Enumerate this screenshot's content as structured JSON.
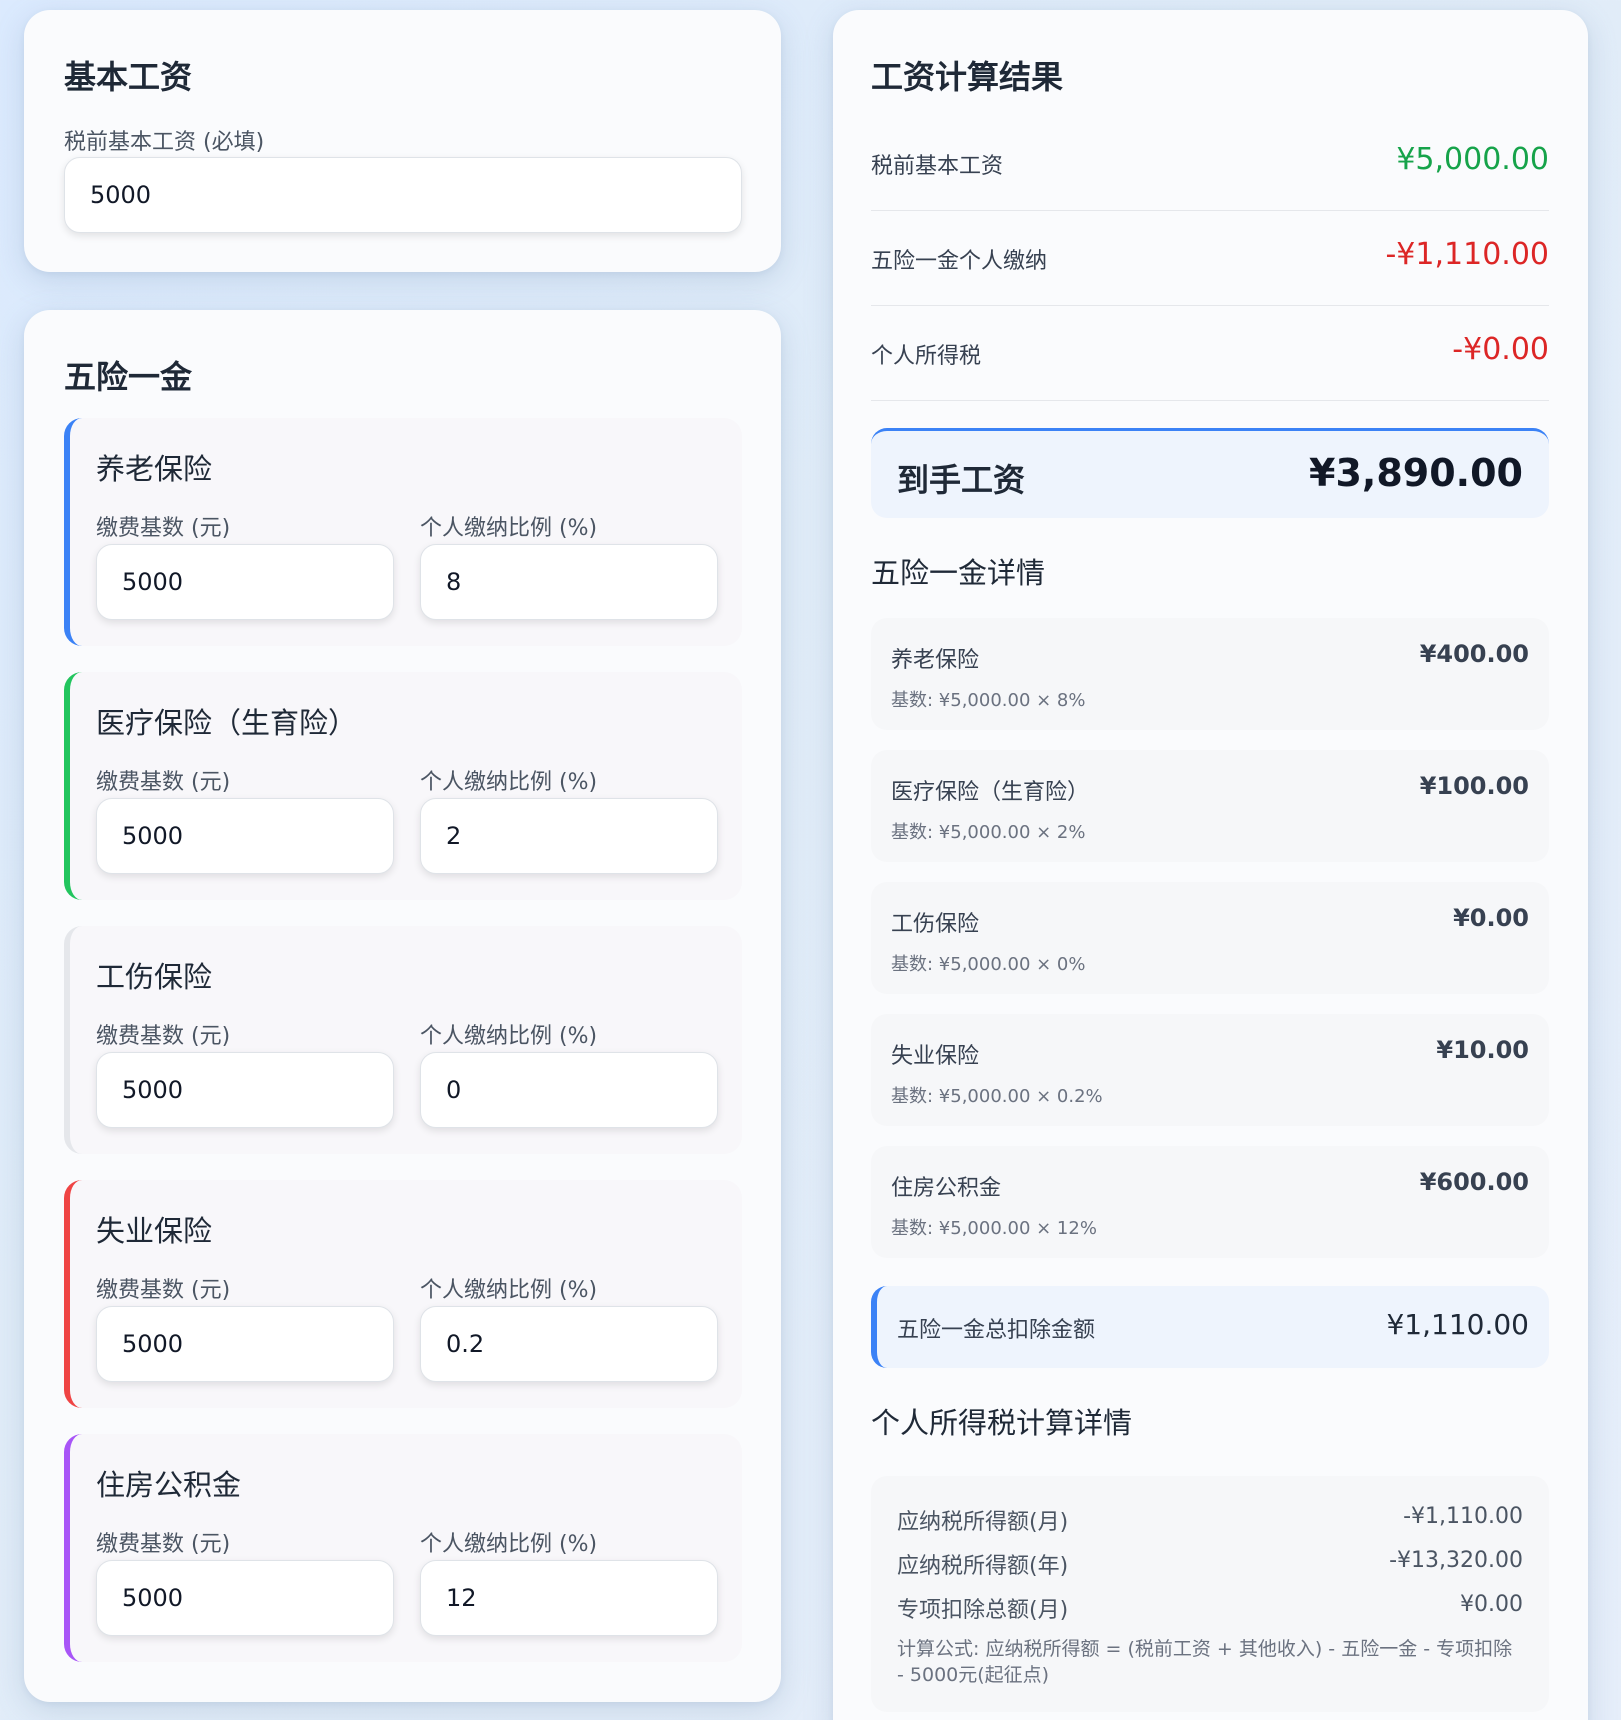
{
  "basic": {
    "title": "基本工资",
    "label": "税前基本工资 (必填)",
    "value": "5000"
  },
  "insurance": {
    "title": "五险一金",
    "base_label": "缴费基数 (元)",
    "rate_label": "个人缴纳比例 (%)",
    "items": [
      {
        "name": "养老保险",
        "base": "5000",
        "rate": "8",
        "color": "#3b82f6"
      },
      {
        "name": "医疗保险（生育险）",
        "base": "5000",
        "rate": "2",
        "color": "#22c55e"
      },
      {
        "name": "工伤保险",
        "base": "5000",
        "rate": "0",
        "color": "#e5e7eb"
      },
      {
        "name": "失业保险",
        "base": "5000",
        "rate": "0.2",
        "color": "#ef4444"
      },
      {
        "name": "住房公积金",
        "base": "5000",
        "rate": "12",
        "color": "#a855f7"
      }
    ]
  },
  "results": {
    "title": "工资计算结果",
    "rows": [
      {
        "label": "税前基本工资",
        "value": "¥5,000.00",
        "color": "#16a34a"
      },
      {
        "label": "五险一金个人缴纳",
        "value": "-¥1,110.00",
        "color": "#dc2626"
      },
      {
        "label": "个人所得税",
        "value": "-¥0.00",
        "color": "#dc2626"
      }
    ],
    "net_label": "到手工资",
    "net_value": "¥3,890.00",
    "details_title": "五险一金详情",
    "details": [
      {
        "name": "养老保险",
        "amount": "¥400.00",
        "formula": "基数: ¥5,000.00 × 8%"
      },
      {
        "name": "医疗保险（生育险）",
        "amount": "¥100.00",
        "formula": "基数: ¥5,000.00 × 2%"
      },
      {
        "name": "工伤保险",
        "amount": "¥0.00",
        "formula": "基数: ¥5,000.00 × 0%"
      },
      {
        "name": "失业保险",
        "amount": "¥10.00",
        "formula": "基数: ¥5,000.00 × 0.2%"
      },
      {
        "name": "住房公积金",
        "amount": "¥600.00",
        "formula": "基数: ¥5,000.00 × 12%"
      }
    ],
    "total_label": "五险一金总扣除金额",
    "total_value": "¥1,110.00",
    "tax_title": "个人所得税计算详情",
    "tax_lines": [
      {
        "label": "应纳税所得额(月)",
        "value": "-¥1,110.00"
      },
      {
        "label": "应纳税所得额(年)",
        "value": "-¥13,320.00"
      },
      {
        "label": "专项扣除总额(月)",
        "value": "¥0.00"
      }
    ],
    "tax_formula": "计算公式: 应纳税所得额 = (税前工资 + 其他收入) - 五险一金 - 专项扣除 - 5000元(起征点)"
  }
}
